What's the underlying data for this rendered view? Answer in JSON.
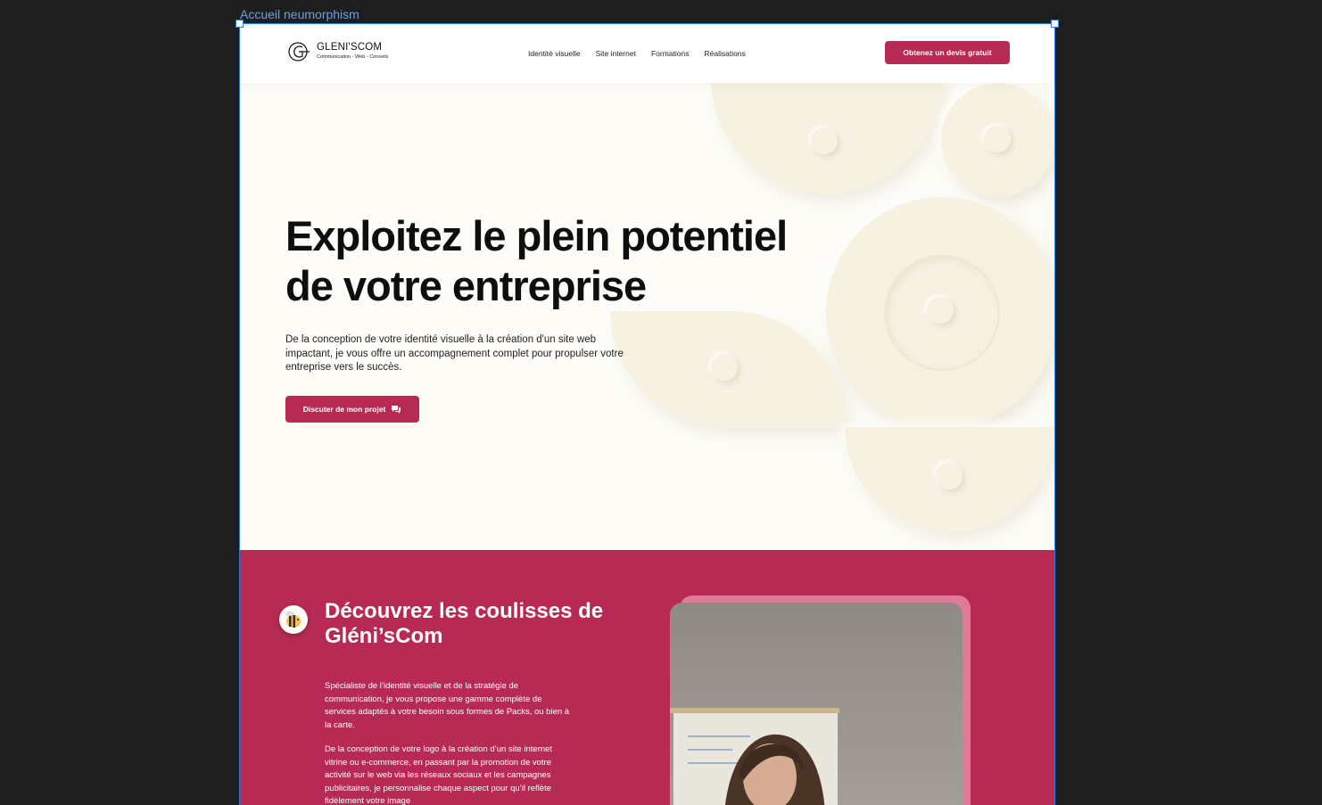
{
  "frame": {
    "label": "Accueil neumorphism"
  },
  "header": {
    "logo_name": "GLENI'SCOM",
    "logo_tagline": "Communication - Web - Conseils",
    "nav": [
      "Identité visuelle",
      "Site internet",
      "Formations",
      "Réalisations"
    ],
    "cta": "Obtenez un devis gratuit"
  },
  "hero": {
    "title_line1": "Exploitez le plein potentiel",
    "title_line2": "de votre entreprise",
    "text": "De la conception de votre identité visuelle à la création d'un site web impactant, je vous offre un accompagnement complet pour propulser votre entreprise vers le succès.",
    "cta": "Discuter de mon projet"
  },
  "about": {
    "title": "Découvrez les coulisses de Gléni’sCom",
    "paragraph1": "Spécialiste de l’identité visuelle et de la stratégie de communication, je vous propose une gamme complète de services adaptés à votre besoin sous formes de Packs, ou bien à la carte.",
    "paragraph2": "De la conception de votre logo à la création d’un site internet vitrine ou e-commerce, en passant par la promotion de votre activité sur le web via les réseaux sociaux et les campagnes publicitaires, je personnalise chaque aspect pour qu’il reflète fidèlement votre image"
  },
  "colors": {
    "brand": "#b62a53",
    "hero_bg": "#fdfcf7",
    "deco": "#f7f1e2"
  },
  "icons": [
    "logo-mark-icon",
    "chat-icon",
    "bee-icon"
  ]
}
